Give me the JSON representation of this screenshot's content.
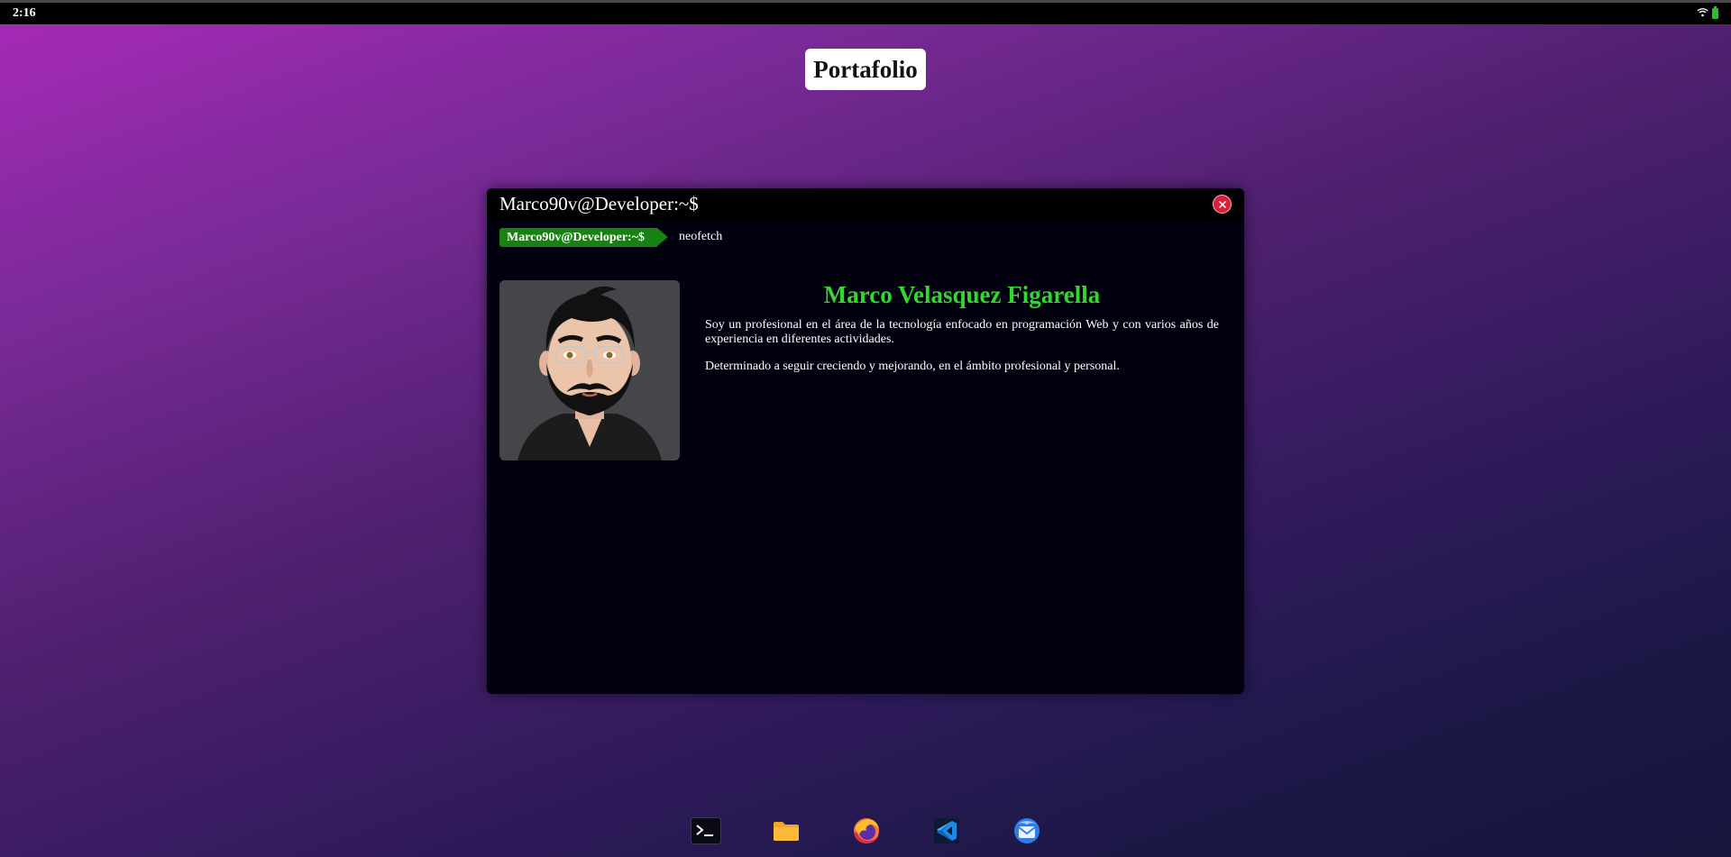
{
  "topbar": {
    "time": "2:16",
    "icons": [
      "wifi-icon",
      "battery-icon"
    ],
    "battery_color": "#21c521"
  },
  "title_chip": {
    "label": "Portafolio"
  },
  "terminal": {
    "title": "Marco90v@Developer:~$",
    "close_icon": "close-icon",
    "prompt": "Marco90v@Developer:~$",
    "command": "neofetch",
    "prompt_color": "#16820f",
    "profile": {
      "name": "Marco Velasquez Figarella",
      "name_color": "#31d82e",
      "paragraphs": [
        "Soy un profesional en el área de la tecnología enfocado en programación Web y con varios años de experiencia en diferentes actividades.",
        "Determinado a seguir creciendo y mejorando, en el ámbito profesional y personal."
      ],
      "avatar_icon": "avatar-illustration"
    }
  },
  "dock": {
    "items": [
      {
        "icon": "terminal-icon"
      },
      {
        "icon": "folder-icon"
      },
      {
        "icon": "firefox-icon"
      },
      {
        "icon": "vscode-icon"
      },
      {
        "icon": "mail-icon"
      }
    ]
  }
}
